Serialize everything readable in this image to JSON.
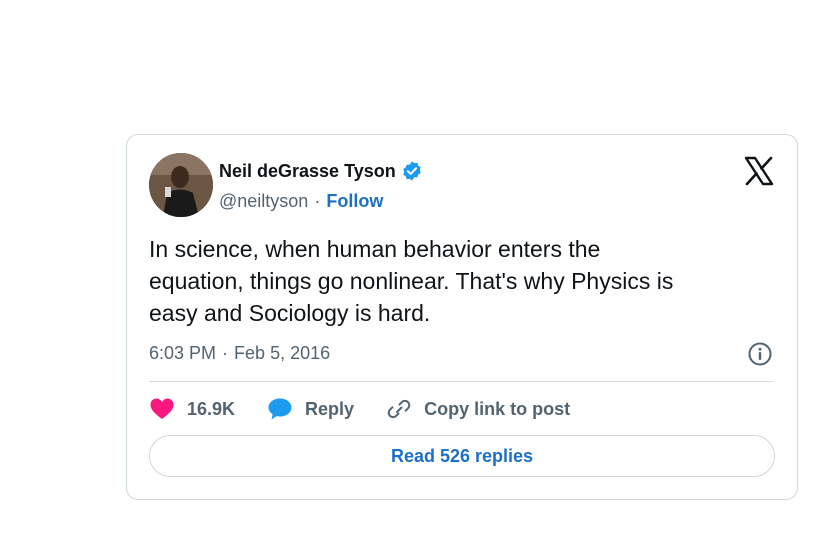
{
  "author": {
    "name": "Neil deGrasse Tyson",
    "handle": "@neiltyson",
    "separator": "·",
    "follow_label": "Follow",
    "verified_color": "#1d9bf0"
  },
  "tweet": {
    "text": "In science, when human behavior  enters the\nequation, things go nonlinear. That's why Physics is\neasy and Sociology is hard.",
    "time": "6:03 PM",
    "date_separator": "·",
    "date": "Feb 5, 2016"
  },
  "actions": {
    "likes_count": "16.9K",
    "reply_label": "Reply",
    "copy_link_label": "Copy link to post",
    "like_color": "#f91880",
    "reply_color": "#1d9bf0"
  },
  "footer": {
    "read_replies_label": "Read 526 replies"
  },
  "icons": {
    "platform": "x-logo-icon",
    "info": "info-icon",
    "like": "heart-icon",
    "reply": "speech-bubble-icon",
    "copy": "link-icon",
    "verified": "verified-badge-icon"
  }
}
